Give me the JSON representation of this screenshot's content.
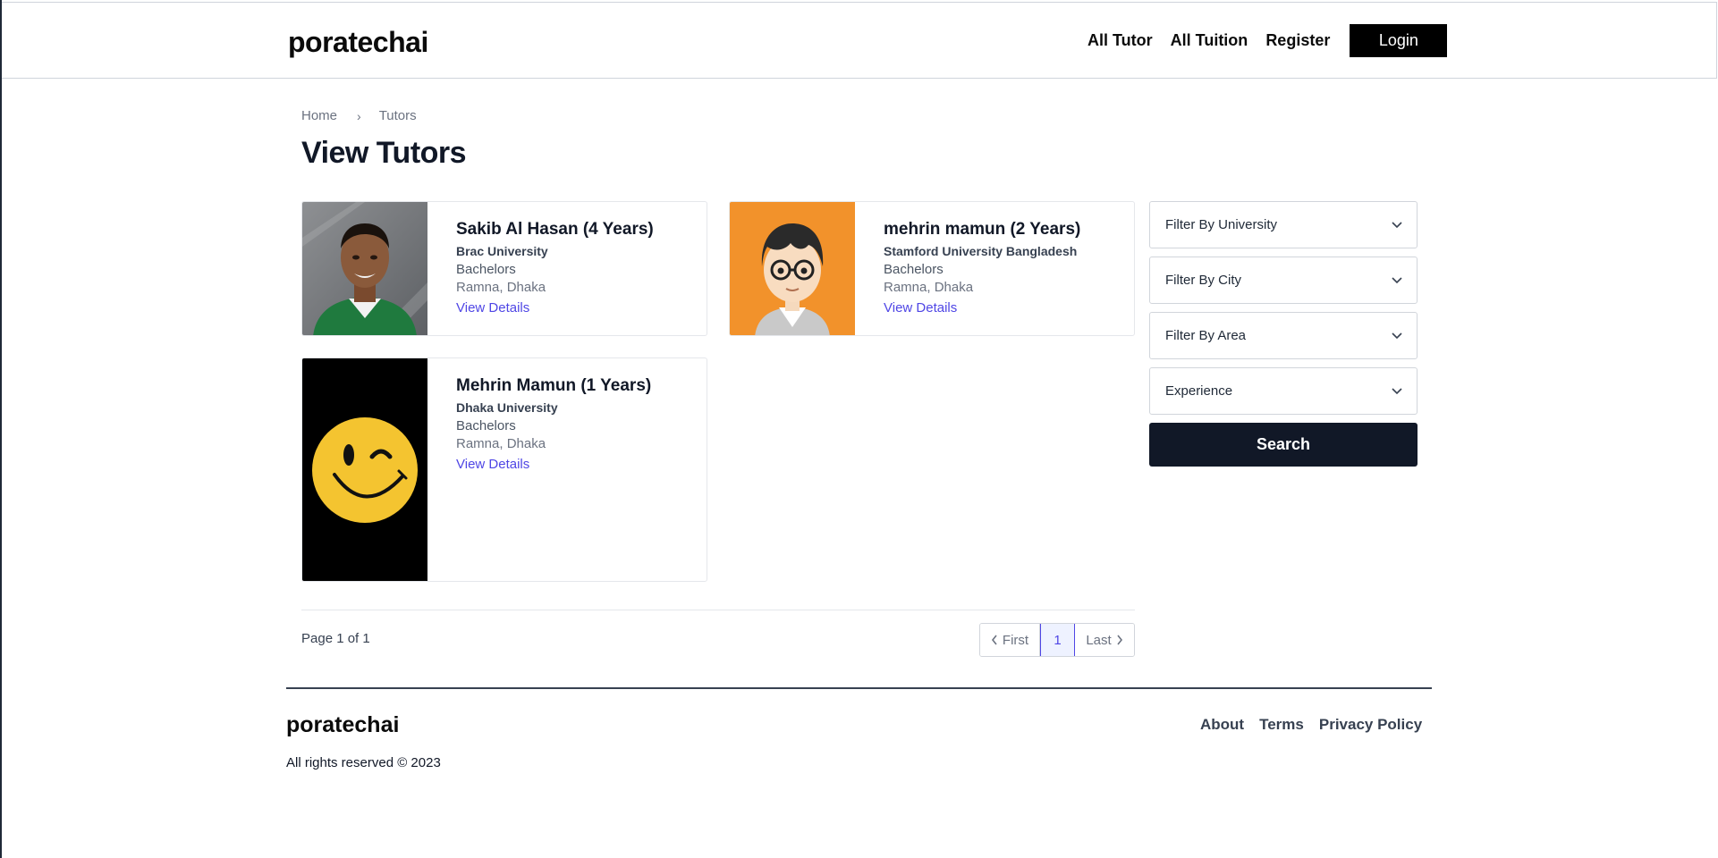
{
  "header": {
    "brand": "poratechai",
    "nav": [
      "All Tutor",
      "All Tuition",
      "Register"
    ],
    "login_label": "Login"
  },
  "breadcrumb": {
    "home": "Home",
    "current": "Tutors"
  },
  "page_title": "View Tutors",
  "tutors": [
    {
      "name": "Sakib Al Hasan (4 Years)",
      "university": "Brac University",
      "degree": "Bachelors",
      "location": "Ramna, Dhaka",
      "link": "View Details",
      "photo": "portrait-photo"
    },
    {
      "name": "mehrin mamun (2 Years)",
      "university": "Stamford University Bangladesh",
      "degree": "Bachelors",
      "location": "Ramna, Dhaka",
      "link": "View Details",
      "photo": "cartoon-avatar"
    },
    {
      "name": "Mehrin Mamun (1 Years)",
      "university": "Dhaka University",
      "degree": "Bachelors",
      "location": "Ramna, Dhaka",
      "link": "View Details",
      "photo": "smiley-face"
    }
  ],
  "filters": {
    "university": "Filter By University",
    "city": "Filter By City",
    "area": "Filter By Area",
    "experience": "Experience",
    "search_label": "Search"
  },
  "pagination": {
    "info": "Page 1 of 1",
    "first": "First",
    "current": "1",
    "last": "Last"
  },
  "footer": {
    "brand": "poratechai",
    "links": [
      "About",
      "Terms",
      "Privacy Policy"
    ],
    "copyright": "All rights reserved © 2023"
  },
  "colors": {
    "accent": "#4f46e5",
    "dark": "#111827",
    "avatar_bg_orange": "#f2922b",
    "smiley_yellow": "#f4c430"
  }
}
